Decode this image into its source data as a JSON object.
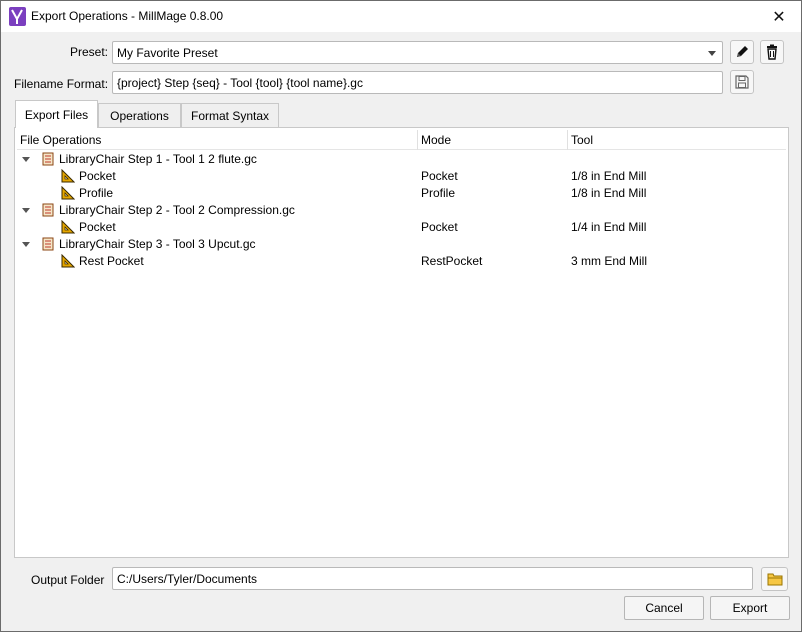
{
  "window": {
    "title": "Export Operations - MillMage 0.8.00",
    "close_glyph": "✕"
  },
  "preset": {
    "label": "Preset:",
    "value": "My Favorite Preset"
  },
  "filename_format": {
    "label": "Filename Format:",
    "value": "{project} Step {seq} - Tool {tool} {tool name}.gc"
  },
  "tabs": [
    {
      "label": "Export Files",
      "active": true
    },
    {
      "label": "Operations",
      "active": false
    },
    {
      "label": "Format Syntax",
      "active": false
    }
  ],
  "tree": {
    "columns": [
      "File Operations",
      "Mode",
      "Tool"
    ],
    "files": [
      {
        "name": "LibraryChair Step 1 - Tool 1 2 flute.gc",
        "operations": [
          {
            "name": "Pocket",
            "mode": "Pocket",
            "tool": "1/8 in End Mill"
          },
          {
            "name": "Profile",
            "mode": "Profile",
            "tool": "1/8 in End Mill"
          }
        ]
      },
      {
        "name": "LibraryChair Step 2 - Tool 2 Compression.gc",
        "operations": [
          {
            "name": "Pocket",
            "mode": "Pocket",
            "tool": "1/4 in End Mill"
          }
        ]
      },
      {
        "name": "LibraryChair Step 3 - Tool 3 Upcut.gc",
        "operations": [
          {
            "name": "Rest Pocket",
            "mode": "RestPocket",
            "tool": "3 mm End Mill"
          }
        ]
      }
    ]
  },
  "output_folder": {
    "label": "Output Folder",
    "value": "C:/Users/Tyler/Documents"
  },
  "buttons": {
    "cancel": "Cancel",
    "export": "Export"
  },
  "icons": {
    "app": "millmage-logo-icon",
    "edit": "pencil-icon",
    "delete": "trash-icon",
    "save": "save-icon",
    "folder": "folder-icon",
    "file": "scroll-file-icon",
    "operation": "set-square-icon"
  },
  "colors": {
    "app_icon": "#7b3fbf",
    "folder_icon": "#e8b100",
    "file_icon": "#c0392b",
    "operation_icon": "#e6a700"
  }
}
